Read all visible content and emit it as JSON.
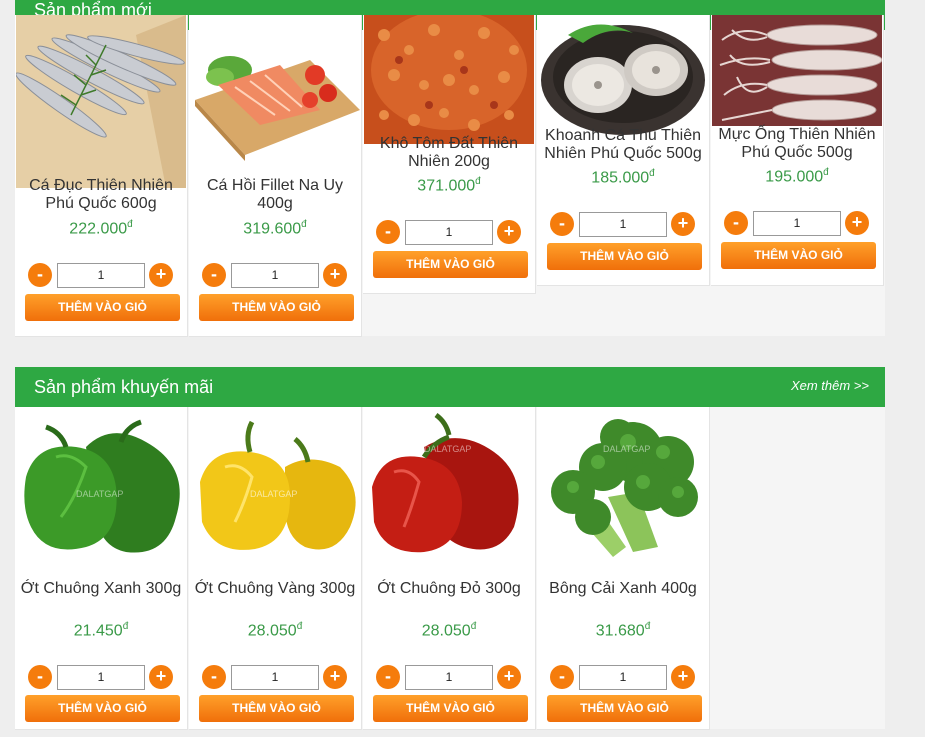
{
  "new_section": {
    "title": "Sản phẩm mới",
    "products": [
      {
        "name": "Cá Đục Thiên Nhiên Phú Quốc 600g",
        "price": "222.000",
        "qty": "1"
      },
      {
        "name": "Cá Hồi Fillet Na Uy 400g",
        "price": "319.600",
        "qty": "1"
      },
      {
        "name": "Khô Tôm Đất Thiên Nhiên 200g",
        "price": "371.000",
        "qty": "1"
      },
      {
        "name": "Khoanh Cá Thu Thiên Nhiên Phú Quốc 500g",
        "price": "185.000",
        "qty": "1"
      },
      {
        "name": "Mực Ống Thiên Nhiên Phú Quốc 500g",
        "price": "195.000",
        "qty": "1"
      }
    ]
  },
  "promo_section": {
    "title": "Sản phẩm khuyến mãi",
    "more_label": "Xem thêm >>",
    "products": [
      {
        "name": "Ớt Chuông Xanh 300g",
        "price": "21.450",
        "qty": "1"
      },
      {
        "name": "Ớt Chuông Vàng 300g",
        "price": "28.050",
        "qty": "1"
      },
      {
        "name": "Ớt Chuông Đỏ 300g",
        "price": "28.050",
        "qty": "1"
      },
      {
        "name": "Bông Cải Xanh 400g",
        "price": "31.680",
        "qty": "1"
      }
    ]
  },
  "common": {
    "currency": "đ",
    "minus": "-",
    "plus": "+",
    "add_to_cart": "THÊM VÀO GIỎ",
    "watermark": "DALATGAP"
  },
  "colors": {
    "header_green": "#2ea843",
    "price_green": "#3a9a48",
    "orange": "#f57c0c"
  }
}
